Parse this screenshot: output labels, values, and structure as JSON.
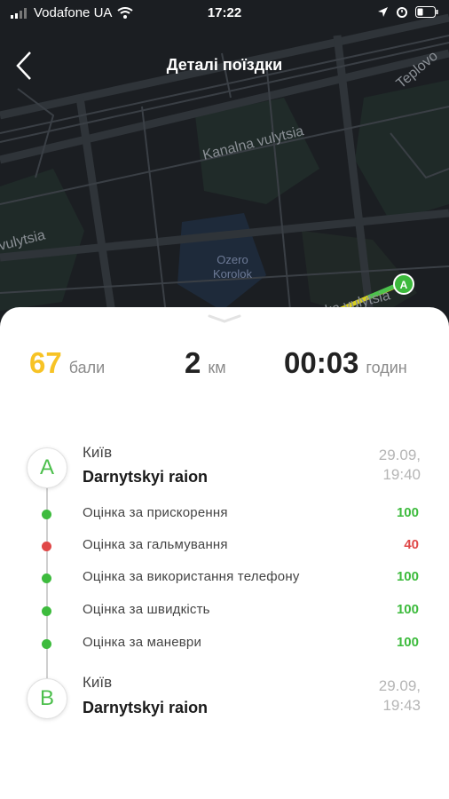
{
  "status_bar": {
    "carrier": "Vodafone UA",
    "time": "17:22"
  },
  "header": {
    "title": "Деталі поїздки"
  },
  "map": {
    "labels": {
      "street_1": "Kanalna vulytsia",
      "street_2": "vulytsia",
      "street_3": "Teplovo",
      "lake_1": "Ozero",
      "lake_2": "Korolok",
      "street_4": "ka vulytsia"
    },
    "marker": "A"
  },
  "stats": {
    "score_value": "67",
    "score_unit": "бали",
    "distance_value": "2",
    "distance_unit": "км",
    "duration_value": "00:03",
    "duration_unit": "годин"
  },
  "route": {
    "start": {
      "marker": "A",
      "city": "Київ",
      "area": "Darnytskyi raion",
      "date": "29.09,",
      "time": "19:40"
    },
    "end": {
      "marker": "B",
      "city": "Київ",
      "area": "Darnytskyi raion",
      "date": "29.09,",
      "time": "19:43"
    },
    "scores": [
      {
        "label": "Оцінка за прискорення",
        "value": "100",
        "status": "good"
      },
      {
        "label": "Оцінка за гальмування",
        "value": "40",
        "status": "bad"
      },
      {
        "label": "Оцінка за використання телефону",
        "value": "100",
        "status": "good"
      },
      {
        "label": "Оцінка за швидкість",
        "value": "100",
        "status": "good"
      },
      {
        "label": "Оцінка за маневри",
        "value": "100",
        "status": "good"
      }
    ]
  },
  "colors": {
    "good": "#3dbb3d",
    "bad": "#e04848",
    "score_accent": "#f7c325"
  }
}
